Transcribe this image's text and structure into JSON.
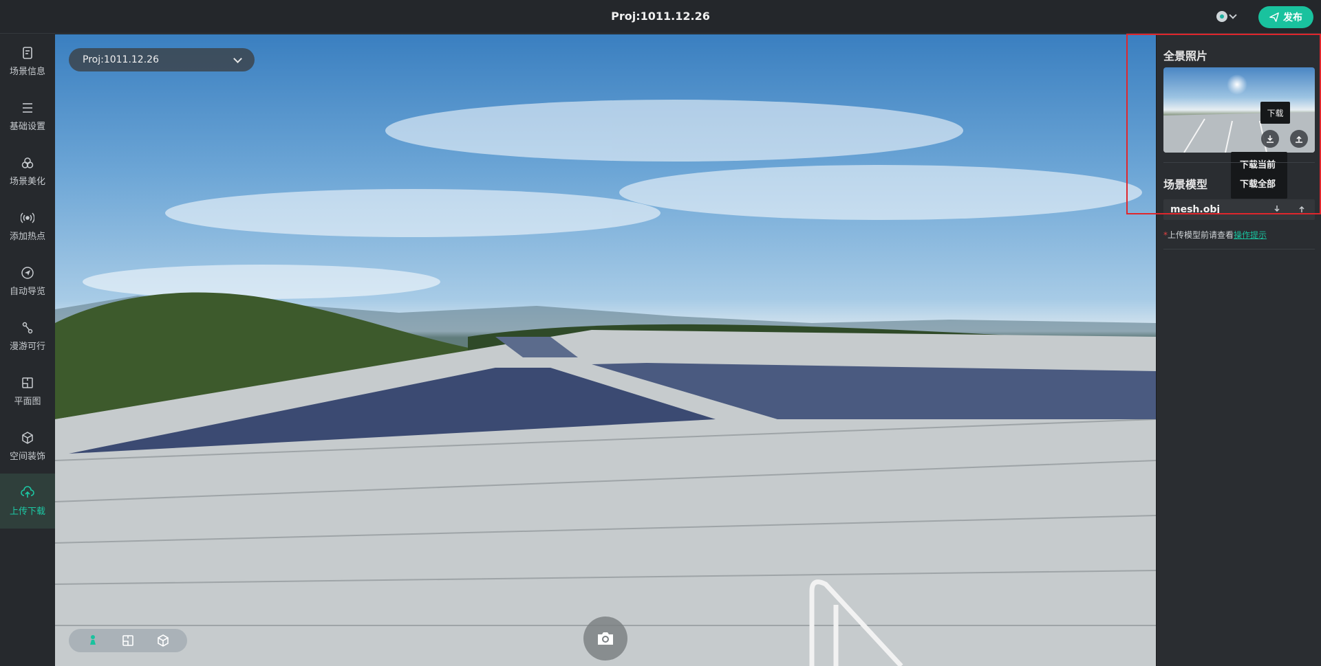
{
  "header": {
    "title": "Proj:1011.12.26",
    "publish_label": "发布"
  },
  "sidebar": {
    "items": [
      {
        "label": "场景信息",
        "icon": "scene-info-icon",
        "active": false
      },
      {
        "label": "基础设置",
        "icon": "list-icon",
        "active": false
      },
      {
        "label": "场景美化",
        "icon": "beautify-icon",
        "active": false
      },
      {
        "label": "添加热点",
        "icon": "hotspot-icon",
        "active": false
      },
      {
        "label": "自动导览",
        "icon": "navigation-icon",
        "active": false
      },
      {
        "label": "漫游可行",
        "icon": "path-icon",
        "active": false
      },
      {
        "label": "平面图",
        "icon": "floorplan-icon",
        "active": false
      },
      {
        "label": "空间装饰",
        "icon": "decoration-icon",
        "active": false
      },
      {
        "label": "上传下载",
        "icon": "upload-download-icon",
        "active": true
      }
    ]
  },
  "viewer": {
    "project_select": "Proj:1011.12.26",
    "tools": [
      "person-icon",
      "floorplan-icon",
      "model-icon"
    ],
    "camera_icon": "camera-icon"
  },
  "panel": {
    "panorama_heading": "全景照片",
    "tooltip": "下载",
    "dropdown": [
      "下载当前",
      "下载全部"
    ],
    "model_heading": "场景模型",
    "model_file": "mesh.obj",
    "hint_prefix": "上传模型前请查看",
    "hint_link": "操作提示"
  },
  "colors": {
    "accent": "#19c29e",
    "highlight": "#e0262c"
  }
}
